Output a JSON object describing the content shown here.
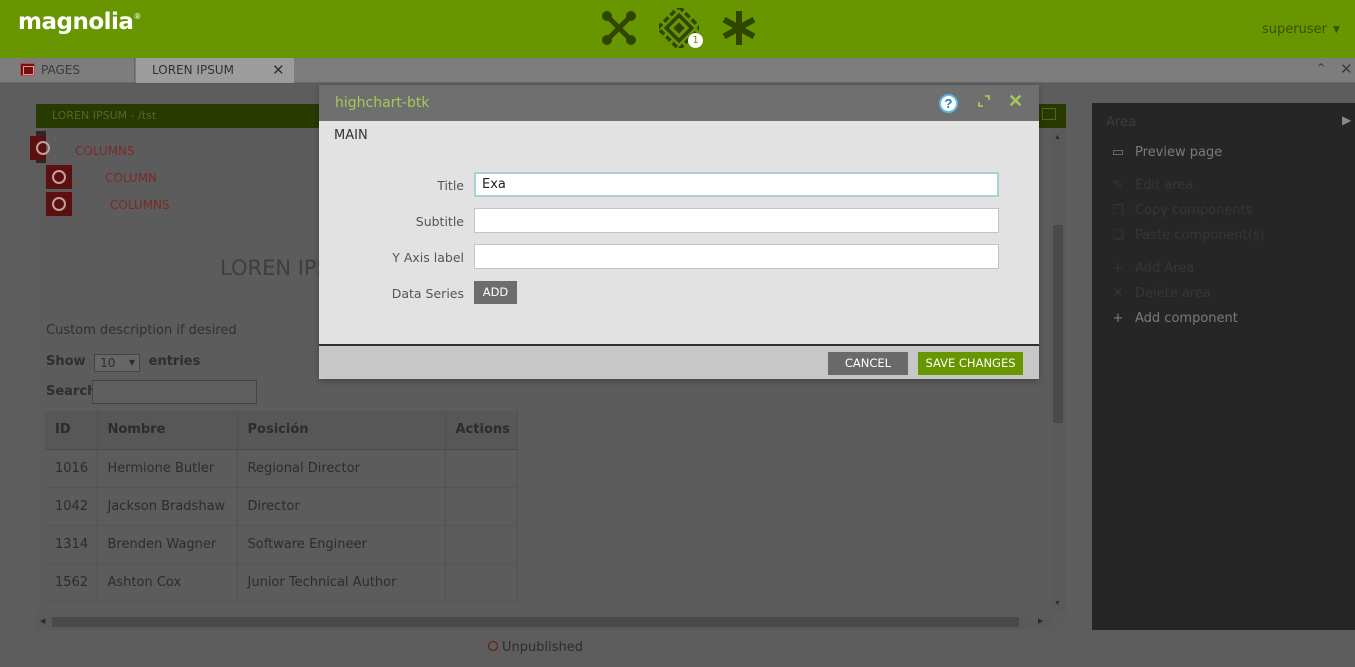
{
  "topbar": {
    "logo": "magnolia",
    "logo_mark": "®",
    "icons": [
      "apps-icon",
      "pulse-icon",
      "favorites-icon"
    ],
    "pulse_badge": "1",
    "user": "superuser"
  },
  "tabs": [
    {
      "label": "PAGES",
      "icon": "pages-icon"
    },
    {
      "label": "LOREN IPSUM",
      "icon": "close-icon"
    }
  ],
  "frame": {
    "title": "LOREN IPSUM - /tst",
    "structure": [
      "COLUMNS",
      "COLUMN",
      "COLUMNS"
    ],
    "heading": "LOREN IPSU",
    "description": "Custom description if desired",
    "show_label": "Show",
    "entries_value": "10",
    "entries_label": "entries",
    "search_label": "Search:",
    "table": {
      "headers": [
        "ID",
        "Nombre",
        "Posición",
        "Actions"
      ],
      "rows": [
        [
          "1016",
          "Hermione Butler",
          "Regional Director",
          ""
        ],
        [
          "1042",
          "Jackson Bradshaw",
          "Director",
          ""
        ],
        [
          "1314",
          "Brenden Wagner",
          "Software Engineer",
          ""
        ],
        [
          "1562",
          "Ashton Cox",
          "Junior Technical Author",
          ""
        ]
      ]
    }
  },
  "status": "Unpublished",
  "actionbar": {
    "title": "Area",
    "items": [
      {
        "label": "Preview page",
        "icon": "preview-icon",
        "enabled": true
      },
      {
        "label": "Edit area",
        "icon": "edit-icon",
        "enabled": false
      },
      {
        "label": "Copy components",
        "icon": "copy-icon",
        "enabled": false
      },
      {
        "label": "Paste component(s)",
        "icon": "paste-icon",
        "enabled": false
      },
      {
        "label": "Add Area",
        "icon": "plus-icon",
        "enabled": false
      },
      {
        "label": "Delete area",
        "icon": "delete-icon",
        "enabled": false
      },
      {
        "label": "Add component",
        "icon": "plus-icon",
        "enabled": true
      }
    ]
  },
  "dialog": {
    "title": "highchart-btk",
    "tab": "MAIN",
    "fields": [
      {
        "label": "Title",
        "value": "Exa",
        "placeholder": ""
      },
      {
        "label": "Subtitle",
        "value": "",
        "placeholder": ""
      },
      {
        "label": "Y Axis label",
        "value": "",
        "placeholder": ""
      }
    ],
    "data_series_label": "Data Series",
    "add_label": "ADD",
    "cancel_label": "CANCEL",
    "save_label": "SAVE CHANGES"
  },
  "colors": {
    "brand": "#689600",
    "brand_light": "#a8c853",
    "help": "#1d7db5"
  }
}
